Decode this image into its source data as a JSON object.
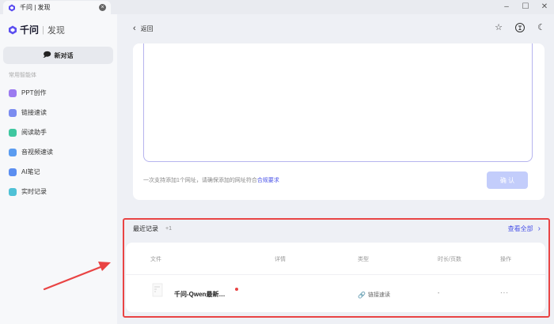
{
  "window": {
    "tab_title": "千问 | 发现",
    "tab_close": "×",
    "minimize": "–",
    "maximize": "☐",
    "close": "✕"
  },
  "sidebar": {
    "brand_name": "千问",
    "brand_sub": "发现",
    "new_chat_label": "新对话",
    "section_label": "常用智能体",
    "items": [
      {
        "label": "PPT创作",
        "color": "#9b7bf0",
        "icon": "ppt-icon"
      },
      {
        "label": "链接速读",
        "color": "#7b8cf0",
        "icon": "link-read-icon"
      },
      {
        "label": "阅读助手",
        "color": "#3fc7a0",
        "icon": "reading-icon"
      },
      {
        "label": "音视频速读",
        "color": "#5b9cf0",
        "icon": "media-icon"
      },
      {
        "label": "AI笔记",
        "color": "#5b8ef0",
        "icon": "note-icon"
      },
      {
        "label": "实时记录",
        "color": "#4fc1d6",
        "icon": "record-icon"
      }
    ]
  },
  "main": {
    "back_label": "返回",
    "hint_text": "一次支持添加1个网址，请确保添加的网址符合",
    "hint_link": "合规要求",
    "confirm_label": "确 认"
  },
  "recent": {
    "title": "最近记录",
    "count": "+1",
    "view_all": "查看全部",
    "columns": [
      "文件",
      "详情",
      "类型",
      "时长/页数",
      "操作"
    ],
    "rows": [
      {
        "file": "千问-Qwen最新…",
        "type": "链接速读",
        "duration": "-",
        "action": "···"
      }
    ]
  },
  "colors": {
    "accent": "#4a53e8",
    "highlight_border": "#e94444",
    "annotation_arrow": "#e94444"
  }
}
